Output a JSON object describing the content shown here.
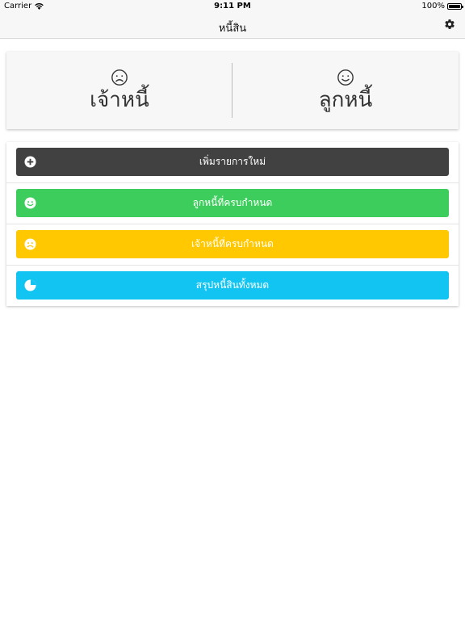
{
  "status_bar": {
    "carrier": "Carrier",
    "time": "9:11 PM",
    "battery": "100%"
  },
  "nav": {
    "title": "หนี้สิน",
    "settings_icon": "gear-icon"
  },
  "summary": {
    "creditor": {
      "label": "เจ้าหนี้",
      "icon": "sad-face-icon"
    },
    "debtor": {
      "label": "ลูกหนี้",
      "icon": "happy-face-icon"
    }
  },
  "actions": [
    {
      "label": "เพิ่มรายการใหม่",
      "icon": "plus-circle-icon",
      "color": "#414141"
    },
    {
      "label": "ลูกหนี้ที่ครบกำหนด",
      "icon": "happy-face-icon",
      "color": "#3ccd5d"
    },
    {
      "label": "เจ้าหนี้ที่ครบกำหนด",
      "icon": "sad-face-icon",
      "color": "#ffc800"
    },
    {
      "label": "สรุปหนี้สินทั้งหมด",
      "icon": "pie-chart-icon",
      "color": "#12c4f2"
    }
  ]
}
